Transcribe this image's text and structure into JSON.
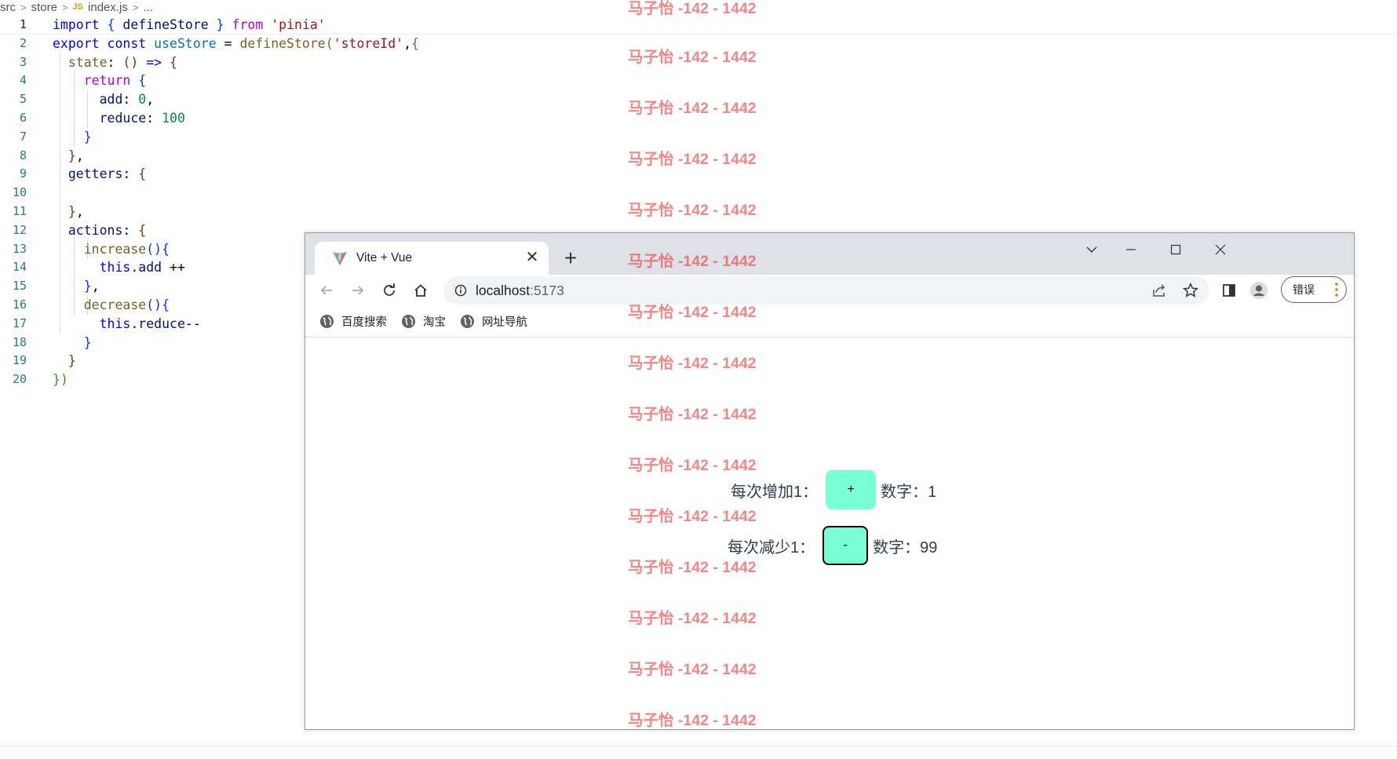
{
  "editor": {
    "breadcrumb": [
      "src",
      "store",
      "index.js",
      "..."
    ],
    "breadcrumb_js_badge": "JS",
    "lines": [
      {
        "n": "1"
      },
      {
        "n": "2"
      },
      {
        "n": "3"
      },
      {
        "n": "4"
      },
      {
        "n": "5"
      },
      {
        "n": "6"
      },
      {
        "n": "7"
      },
      {
        "n": "8"
      },
      {
        "n": "9"
      },
      {
        "n": "10"
      },
      {
        "n": "11"
      },
      {
        "n": "12"
      },
      {
        "n": "13"
      },
      {
        "n": "14"
      },
      {
        "n": "15"
      },
      {
        "n": "16"
      },
      {
        "n": "17"
      },
      {
        "n": "18"
      },
      {
        "n": "19"
      },
      {
        "n": "20"
      }
    ],
    "tokens": {
      "import": "import",
      "lbrace": "{",
      "defineStore": "defineStore",
      "rbrace": "}",
      "from": "from",
      "pinia": "'pinia'",
      "export": "export",
      "const": "const",
      "useStore": "useStore",
      "eq": "=",
      "defineStoreCall": "defineStore",
      "lparen": "(",
      "storeId": "'storeId'",
      "comma": ",",
      "rparen": ")",
      "state": "state",
      "colon": ":",
      "arrowParens": "()",
      "arrow": "=>",
      "return": "return",
      "add": "add",
      "zero": "0",
      "reduce": "reduce",
      "hundred": "100",
      "getters": "getters",
      "actions": "actions",
      "increase": "increase",
      "this": "this",
      "dotAdd": ".add",
      "plusplus": "++",
      "decrease": "decrease",
      "dotReduce": ".reduce",
      "minusminus": "--"
    }
  },
  "browser": {
    "tab_title": "Vite + Vue",
    "tab_close": "✕",
    "new_tab": "+",
    "url_host": "localhost",
    "url_port": ":5173",
    "error_button": "错误",
    "bookmarks": [
      "百度搜索",
      "淘宝",
      "网址导航"
    ]
  },
  "app": {
    "increase_label": "每次增加1：",
    "increase_button": "+",
    "increase_value": "数字：1",
    "decrease_label": "每次减少1：",
    "decrease_button": "-",
    "decrease_value": "数字：99"
  },
  "watermark": "马子怡 -142 - 1442",
  "colors": {
    "button_bg": "#7affd4",
    "watermark": "#ee3a3a"
  }
}
